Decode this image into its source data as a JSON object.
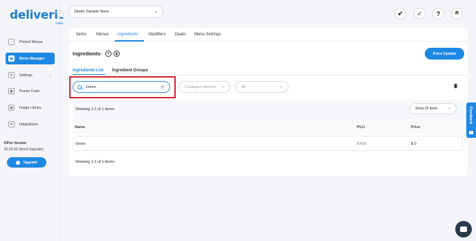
{
  "brand": {
    "name": "deliverit",
    "sub": "ORIO",
    "color": "#1e88e5"
  },
  "sidebar": {
    "collapse": "‹",
    "items": [
      {
        "label": "Pinned Menus",
        "icon": "pin-icon",
        "glyph": "▪"
      },
      {
        "label": "Menu Manager",
        "icon": "menu-icon",
        "glyph": "▤",
        "active": true
      },
      {
        "label": "Settings",
        "icon": "gear-icon",
        "glyph": "⚙",
        "caret": "⌄"
      },
      {
        "label": "Promo Code",
        "icon": "promo-icon",
        "glyph": "▣"
      },
      {
        "label": "Image Library",
        "icon": "image-icon",
        "glyph": "▦"
      },
      {
        "label": "Integrations",
        "icon": "integrations-icon",
        "glyph": "⇄"
      }
    ],
    "version_title": "DPos Version",
    "version_text": "02.20.50 (Need Upgrade)",
    "upgrade_label": "Upgrade"
  },
  "topbar": {
    "store": "Studio Sample Store",
    "chev": "⌄",
    "icons": [
      {
        "name": "rocket-icon",
        "glyph": "➶"
      },
      {
        "name": "rocket-outline-icon",
        "glyph": "➶"
      },
      {
        "name": "help-icon",
        "glyph": "?"
      },
      {
        "name": "profile-icon",
        "glyph": "R"
      }
    ]
  },
  "tabs": [
    "Items",
    "Menus",
    "Ingredients",
    "Modifiers",
    "Deals",
    "Menu Settings"
  ],
  "active_tab": "Ingredients",
  "page": {
    "title": "Ingredients",
    "add_glyph": "+",
    "bookmark_glyph": "▮",
    "price_update": "Price Update"
  },
  "subtabs": [
    "Ingredients List",
    "Ingredient Groups"
  ],
  "filters": {
    "search_value": "Onion",
    "clear_glyph": "×",
    "category": "0 Category selected",
    "status": "All",
    "chev": "⌄",
    "filter_glyph": "⩩"
  },
  "pagination": {
    "showing_top": "Showing 1-1 of 1 items.",
    "page_size": "Show 25 items",
    "showing_bottom": "Showing 1-1 of 1 items."
  },
  "table": {
    "headers": [
      "Name",
      "PLU",
      "Price"
    ],
    "rows": [
      {
        "name": "Onion",
        "plu": "EX06",
        "price": "$ 0"
      }
    ]
  },
  "feedback": {
    "label": "Feedback"
  }
}
